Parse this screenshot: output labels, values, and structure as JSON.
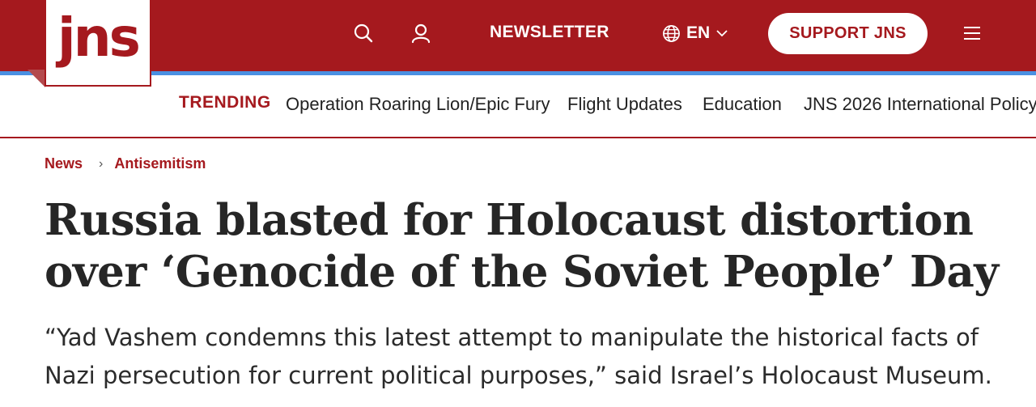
{
  "header": {
    "logo_text": "jns",
    "newsletter_label": "NEWSLETTER",
    "language_label": "EN",
    "support_label": "SUPPORT JNS",
    "icons": [
      "search-icon",
      "user-icon",
      "globe-icon",
      "chevron-down-icon",
      "menu-icon"
    ],
    "brand_color": "#a5191e",
    "stripe_color": "#4a90e2"
  },
  "trending": {
    "label": "TRENDING",
    "links": [
      "Operation Roaring Lion/Epic Fury",
      "Flight Updates",
      "Education",
      "JNS 2026 International Policy"
    ]
  },
  "breadcrumb": {
    "items": [
      "News",
      "Antisemitism"
    ]
  },
  "article": {
    "headline": "Russia blasted for Holocaust distortion over ‘Genocide of the Soviet People’ Day",
    "subhead": "“Yad Vashem condemns this latest attempt to manipulate the historical facts of Nazi persecution for current political purposes,” said Israel’s Holocaust Museum."
  }
}
